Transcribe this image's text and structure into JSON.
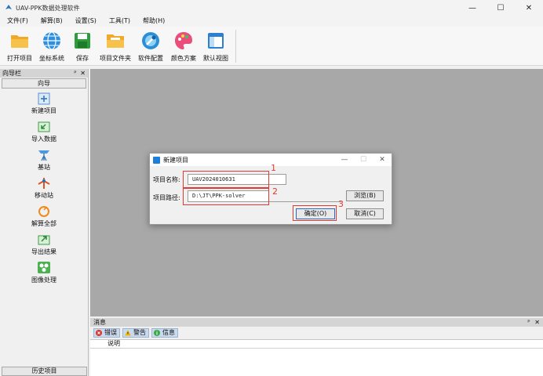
{
  "window": {
    "title": "UAV-PPK数据处理软件",
    "min_symbol": "—",
    "max_symbol": "☐",
    "close_symbol": "✕"
  },
  "menu": [
    "文件(F)",
    "解算(B)",
    "设置(S)",
    "工具(T)",
    "帮助(H)"
  ],
  "toolbar": [
    {
      "label": "打开项目",
      "icon": "open-folder-icon"
    },
    {
      "label": "坐标系统",
      "icon": "globe-icon"
    },
    {
      "label": "保存",
      "icon": "save-icon"
    },
    {
      "label": "项目文件夹",
      "icon": "project-folder-icon"
    },
    {
      "label": "软件配置",
      "icon": "config-icon"
    },
    {
      "label": "颜色方案",
      "icon": "palette-icon"
    },
    {
      "label": "默认视图",
      "icon": "default-view-icon"
    }
  ],
  "nav": {
    "panel_title": "向导栏",
    "section": "向导",
    "pin": "ᵖ",
    "close": "✕",
    "items": [
      {
        "label": "新建项目",
        "icon": "new-project-icon"
      },
      {
        "label": "导入数据",
        "icon": "import-data-icon"
      },
      {
        "label": "基站",
        "icon": "base-station-icon"
      },
      {
        "label": "移动站",
        "icon": "rover-icon"
      },
      {
        "label": "解算全部",
        "icon": "solve-all-icon"
      },
      {
        "label": "导出结果",
        "icon": "export-icon"
      },
      {
        "label": "图像处理",
        "icon": "image-process-icon"
      }
    ],
    "bottom": "历史项目"
  },
  "dialog": {
    "title": "新建项目",
    "name_label": "项目名称:",
    "name_value": "UAV2024010631",
    "path_label": "项目路径:",
    "path_value": "D:\\JT\\PPK-solver",
    "browse": "浏览(B)",
    "ok": "确定(O)",
    "cancel": "取消(C)",
    "annotations": [
      "1",
      "2",
      "3"
    ],
    "annotation_color": "#e23a32"
  },
  "messages": {
    "title": "消息",
    "tabs": [
      {
        "label": "错误",
        "icon": "error-icon"
      },
      {
        "label": "警告",
        "icon": "warning-icon"
      },
      {
        "label": "信息",
        "icon": "info-icon"
      }
    ],
    "column": "说明"
  }
}
